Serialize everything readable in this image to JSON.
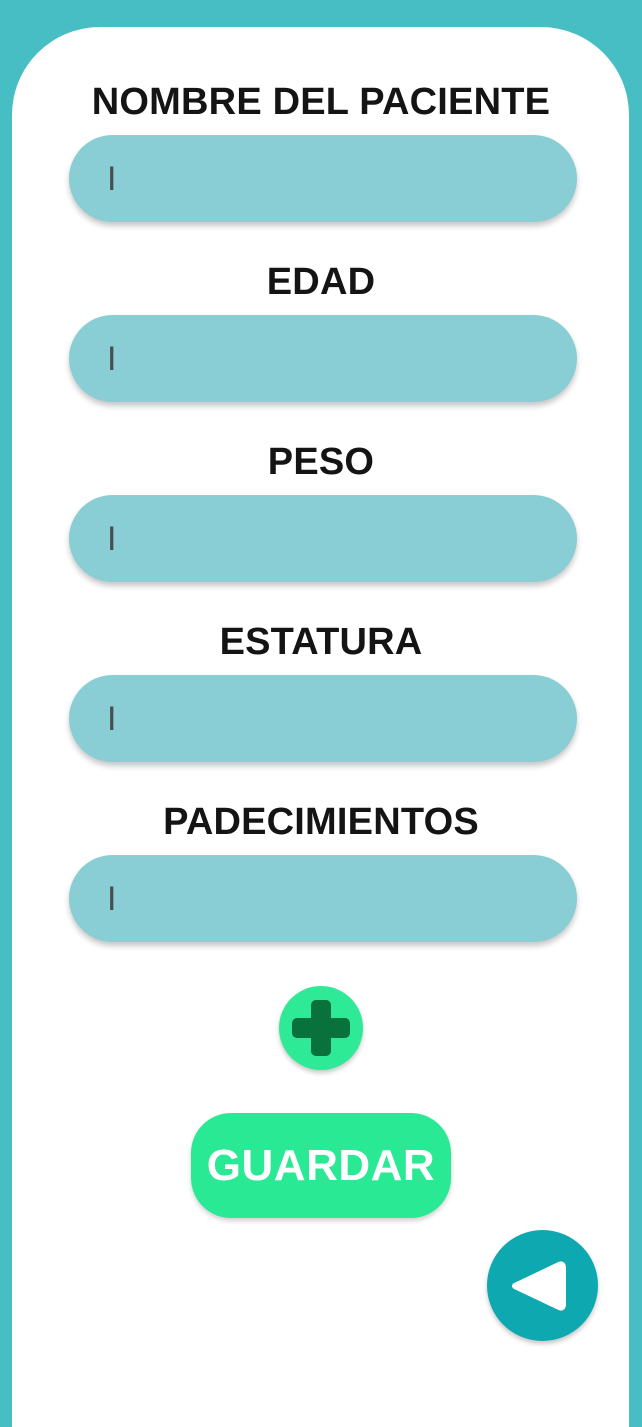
{
  "form": {
    "fields": [
      {
        "label": "NOMBRE DEL PACIENTE",
        "value": "",
        "caret": "I"
      },
      {
        "label": "EDAD",
        "value": "",
        "caret": "I"
      },
      {
        "label": "PESO",
        "value": "",
        "caret": "I"
      },
      {
        "label": "ESTATURA",
        "value": "",
        "caret": "I"
      },
      {
        "label": "PADECIMIENTOS",
        "value": "",
        "caret": "I"
      }
    ]
  },
  "actions": {
    "save_label": "GUARDAR",
    "add_icon": "plus-icon",
    "back_icon": "back-triangle-icon"
  },
  "colors": {
    "background": "#46bec4",
    "card": "#ffffff",
    "input": "#89ced4",
    "accent_green": "#2ee995",
    "plus_icon": "#08713c",
    "back_button": "#0ea9b0"
  }
}
